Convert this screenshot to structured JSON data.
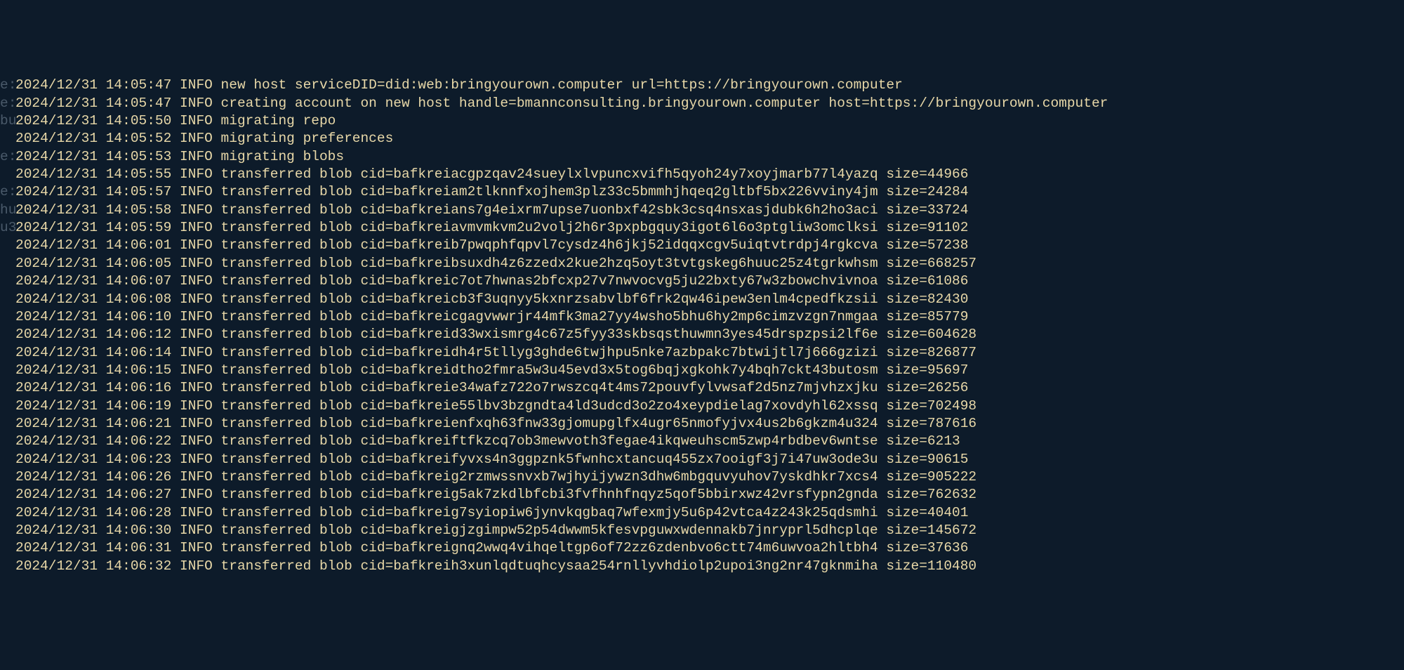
{
  "gutter_fragments": [
    "e:",
    "e:",
    "bu",
    "",
    "e:",
    "",
    "e:",
    "hu",
    "u3",
    "  ",
    "",
    "",
    "",
    "",
    "",
    "",
    "",
    "",
    "",
    "",
    "",
    "",
    "",
    "",
    "",
    "",
    "",
    ""
  ],
  "lines": [
    "2024/12/31 14:05:47 INFO new host serviceDID=did:web:bringyourown.computer url=https://bringyourown.computer",
    "2024/12/31 14:05:47 INFO creating account on new host handle=bmannconsulting.bringyourown.computer host=https://bringyourown.computer",
    "2024/12/31 14:05:50 INFO migrating repo",
    "2024/12/31 14:05:52 INFO migrating preferences",
    "2024/12/31 14:05:53 INFO migrating blobs",
    "2024/12/31 14:05:55 INFO transferred blob cid=bafkreiacgpzqav24sueylxlvpuncxvifh5qyoh24y7xoyjmarb77l4yazq size=44966",
    "2024/12/31 14:05:57 INFO transferred blob cid=bafkreiam2tlknnfxojhem3plz33c5bmmhjhqeq2gltbf5bx226vviny4jm size=24284",
    "2024/12/31 14:05:58 INFO transferred blob cid=bafkreians7g4eixrm7upse7uonbxf42sbk3csq4nsxasjdubk6h2ho3aci size=33724",
    "2024/12/31 14:05:59 INFO transferred blob cid=bafkreiavmvmkvm2u2volj2h6r3pxpbgquy3igot6l6o3ptgliw3omclksi size=91102",
    "2024/12/31 14:06:01 INFO transferred blob cid=bafkreib7pwqphfqpvl7cysdz4h6jkj52idqqxcgv5uiqtvtrdpj4rgkcva size=57238",
    "2024/12/31 14:06:05 INFO transferred blob cid=bafkreibsuxdh4z6zzedx2kue2hzq5oyt3tvtgskeg6huuc25z4tgrkwhsm size=668257",
    "2024/12/31 14:06:07 INFO transferred blob cid=bafkreic7ot7hwnas2bfcxp27v7nwvocvg5ju22bxty67w3zbowchvivnoa size=61086",
    "2024/12/31 14:06:08 INFO transferred blob cid=bafkreicb3f3uqnyy5kxnrzsabvlbf6frk2qw46ipew3enlm4cpedfkzsii size=82430",
    "2024/12/31 14:06:10 INFO transferred blob cid=bafkreicgagvwwrjr44mfk3ma27yy4wsho5bhu6hy2mp6cimzvzgn7nmgaa size=85779",
    "2024/12/31 14:06:12 INFO transferred blob cid=bafkreid33wxismrg4c67z5fyy33skbsqsthuwmn3yes45drspzpsi2lf6e size=604628",
    "2024/12/31 14:06:14 INFO transferred blob cid=bafkreidh4r5tllyg3ghde6twjhpu5nke7azbpakc7btwijtl7j666gzizi size=826877",
    "2024/12/31 14:06:15 INFO transferred blob cid=bafkreidtho2fmra5w3u45evd3x5tog6bqjxgkohk7y4bqh7ckt43butosm size=95697",
    "2024/12/31 14:06:16 INFO transferred blob cid=bafkreie34wafz722o7rwszcq4t4ms72pouvfylvwsaf2d5nz7mjvhzxjku size=26256",
    "2024/12/31 14:06:19 INFO transferred blob cid=bafkreie55lbv3bzgndta4ld3udcd3o2zo4xeypdielag7xovdyhl62xssq size=702498",
    "2024/12/31 14:06:21 INFO transferred blob cid=bafkreienfxqh63fnw33gjomupglfx4ugr65nmofyjvx4us2b6gkzm4u324 size=787616",
    "2024/12/31 14:06:22 INFO transferred blob cid=bafkreiftfkzcq7ob3mewvoth3fegae4ikqweuhscm5zwp4rbdbev6wntse size=6213",
    "2024/12/31 14:06:23 INFO transferred blob cid=bafkreifyvxs4n3ggpznk5fwnhcxtancuq455zx7ooigf3j7i47uw3ode3u size=90615",
    "2024/12/31 14:06:26 INFO transferred blob cid=bafkreig2rzmwssnvxb7wjhyijywzn3dhw6mbgquvyuhov7yskdhkr7xcs4 size=905222",
    "2024/12/31 14:06:27 INFO transferred blob cid=bafkreig5ak7zkdlbfcbi3fvfhnhfnqyz5qof5bbirxwz42vrsfypn2gnda size=762632",
    "2024/12/31 14:06:28 INFO transferred blob cid=bafkreig7syiopiw6jynvkqgbaq7wfexmjy5u6p42vtca4z243k25qdsmhi size=40401",
    "2024/12/31 14:06:30 INFO transferred blob cid=bafkreigjzgimpw52p54dwwm5kfesvpguwxwdennakb7jnryprl5dhcplqe size=145672",
    "2024/12/31 14:06:31 INFO transferred blob cid=bafkreignq2wwq4vihqeltgp6of72zz6zdenbvo6ctt74m6uwvoa2hltbh4 size=37636",
    "2024/12/31 14:06:32 INFO transferred blob cid=bafkreih3xunlqdtuqhcysaa254rnllyvhdiolp2upoi3ng2nr47gknmiha size=110480"
  ]
}
